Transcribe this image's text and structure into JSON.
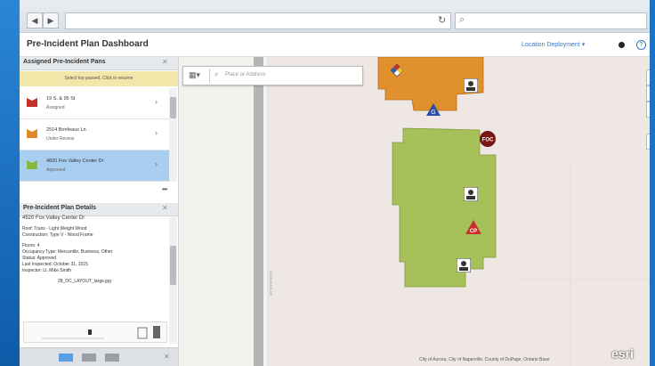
{
  "browser": {
    "back_icon": "back-arrow-icon",
    "forward_icon": "forward-arrow-icon",
    "url": "",
    "refresh_icon": "refresh-icon",
    "search_icon": "search-icon",
    "search_value": ""
  },
  "header": {
    "title": "Pre-Incident Plan Dashboard",
    "location_dropdown": "Location Deployment ▾",
    "help_label": "?"
  },
  "assigned_panel": {
    "title": "Assigned Pre-Incident Pans",
    "close_label": "✕",
    "banner": "Select top passed. Click to resume",
    "items": [
      {
        "title": "19 S. & 95 St",
        "status": "Assigned",
        "color": "#c9302c"
      },
      {
        "title": "2514 Bonfeaux Ln",
        "status": "Under Review",
        "color": "#e0882a"
      },
      {
        "title": "4820 Fox Valley Center Dr",
        "status": "Approved",
        "color": "#8ab83c"
      }
    ],
    "more_label": "•••"
  },
  "details_panel": {
    "title": "Pre-Incident Plan Details",
    "close_label": "✕",
    "address": "4520 Fox Valley Center Dr",
    "roof": "Roof: Trans - Light Weight Wood",
    "construction": "Construction: Type V - Wood Frame",
    "floors": "Floors: 4",
    "occupancy": "Occupancy Type: Mercantile, Business, Other",
    "status": "Status: Approved",
    "last_inspected": "Last Inspected: October 31, 2015",
    "inspector": "Inspector: Lt. Mike Smith",
    "attachment": "28_DC_LAYOUT_large.jpg"
  },
  "footer": {
    "pages": 3,
    "active_page": 0,
    "close_label": "✕"
  },
  "map": {
    "search_placeholder": "Place or Address",
    "layers_icon": "layers-grid-icon",
    "zoom_in": "+",
    "home_icon": "home-icon",
    "zoom_out": "−",
    "locate_icon": "locate-circle-icon",
    "road_label": "COMMONS DR",
    "badge_foc": "FOC",
    "badge_cp": "CP",
    "attribution": "City of Aurora, City of Naperville, County of DuPage, Ontario Base",
    "esri_logo": "esri",
    "colors": {
      "orange_building": "#e0912d",
      "green_building": "#a6c15a"
    }
  }
}
